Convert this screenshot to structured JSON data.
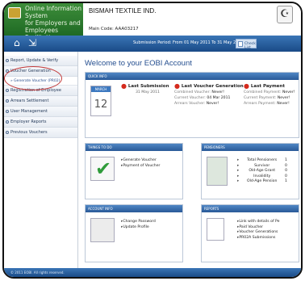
{
  "header": {
    "system_lines": [
      "Online Information System",
      "for Employers and",
      "Employees Facilitation"
    ],
    "company": "BISMAH TEXTILE IND.",
    "main_code": "Main Code: AAA03217"
  },
  "nav": {
    "period": "Submission Period: From 01 May 2011  To 31 May 2011",
    "checklist": "Check List"
  },
  "sidebar": {
    "items": [
      "Report, Update & Verify",
      "Voucher Generation",
      "Registration of Employee",
      "Arrears Settlement",
      "User Management",
      "Employer Reports",
      "Previous Vouchers"
    ],
    "sub_item": "» Generate Voucher (PR02)",
    "footer": "© 2011 EOBI. All rights reserved."
  },
  "main": {
    "welcome": "Welcome to your EOBI Account",
    "quick_info": {
      "title": "QUICK INFO",
      "cal_month": "MARCH",
      "cal_day": "12",
      "last_submission_label": "Last Submission",
      "last_submission_date": "31 May 2011",
      "last_voucher_label": "Last Voucher Generation",
      "combined_voucher": "Combined Voucher:",
      "combined_voucher_val": "Never!",
      "current_voucher": "Current Voucher:",
      "current_voucher_val": "04 Mar 2011",
      "arrears_voucher": "Arrears Voucher:",
      "arrears_voucher_val": "Never!",
      "last_payment_label": "Last Payment",
      "combined_payment": "Combined Payment:",
      "combined_payment_val": "Never!",
      "current_payment": "Current Payment:",
      "current_payment_val": "Never!",
      "arrears_payment": "Arrears Payment:",
      "arrears_payment_val": "Never!"
    },
    "todo": {
      "title": "THINGS TO DO",
      "items": [
        "Generate Voucher",
        "Payment of Voucher"
      ]
    },
    "pensioners": {
      "title": "PENSIONERS",
      "rows": [
        {
          "label": "Total Pensioners",
          "value": "1"
        },
        {
          "label": "Survivor",
          "value": "0"
        },
        {
          "label": "Old-Age Grant",
          "value": "0"
        },
        {
          "label": "Invalidity",
          "value": "0"
        },
        {
          "label": "Old-Age Pension",
          "value": "1"
        }
      ]
    },
    "account_info": {
      "title": "ACCOUNT INFO",
      "items": [
        "Change Password",
        "Update Profile"
      ]
    },
    "reports": {
      "title": "REPORTS",
      "items": [
        "Link with details of Pe",
        "Paid Voucher",
        "Voucher Generations",
        "PR02A Submissions"
      ]
    }
  }
}
